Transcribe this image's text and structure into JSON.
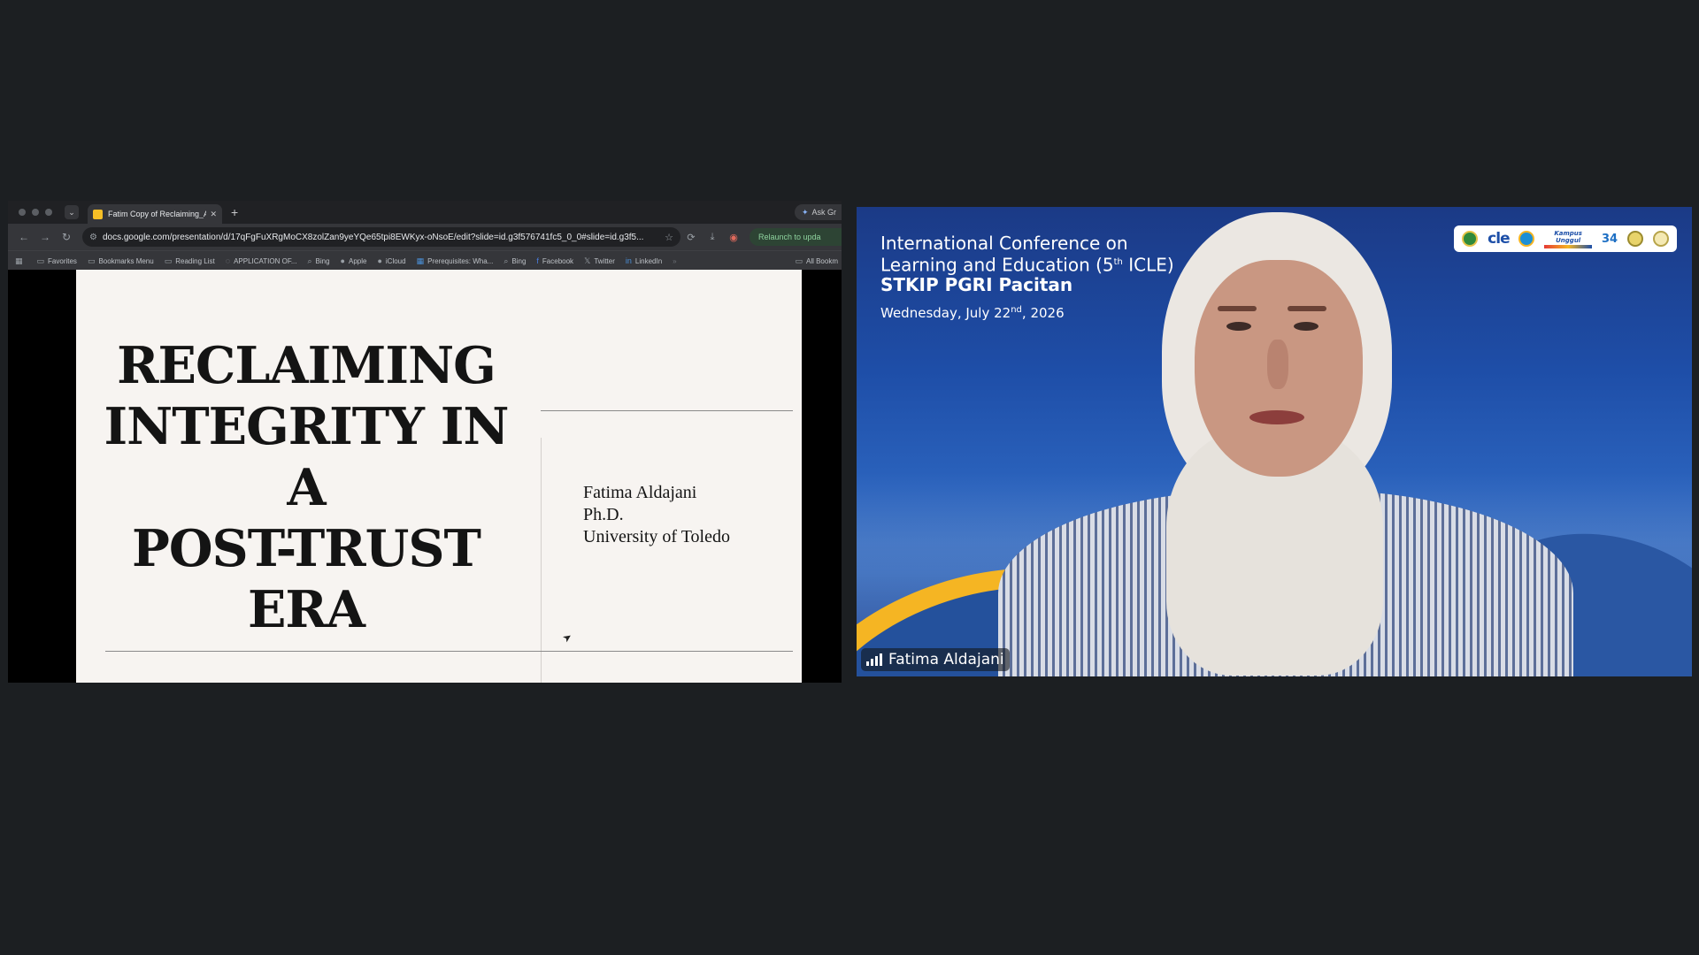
{
  "browser": {
    "tab_title": "Fatim Copy of Reclaiming_Ac",
    "tab_close": "✕",
    "new_tab": "+",
    "ask_button": "Ask Gr",
    "url": "docs.google.com/presentation/d/17qFgFuXRgMoCX8zolZan9yeYQe65tpi8EWKyx-oNsoE/edit?slide=id.g3f576741fc5_0_0#slide=id.g3f5...",
    "relaunch": "Relaunch to upda",
    "bookmarks": [
      {
        "label": "Favorites",
        "icon": "folder-icon"
      },
      {
        "label": "Bookmarks Menu",
        "icon": "folder-icon"
      },
      {
        "label": "Reading List",
        "icon": "folder-icon"
      },
      {
        "label": "APPLICATION OF...",
        "icon": "globe-icon"
      },
      {
        "label": "Bing",
        "icon": "search-icon"
      },
      {
        "label": "Apple",
        "icon": "apple-icon"
      },
      {
        "label": "iCloud",
        "icon": "apple-icon"
      },
      {
        "label": "Prerequisites: Wha...",
        "icon": "grid-icon"
      },
      {
        "label": "Bing",
        "icon": "search-icon"
      },
      {
        "label": "Facebook",
        "icon": "facebook-icon"
      },
      {
        "label": "Twitter",
        "icon": "x-icon"
      },
      {
        "label": "LinkedIn",
        "icon": "linkedin-icon"
      }
    ],
    "bookmarks_overflow": "»",
    "all_bookmarks": "All Bookm"
  },
  "slide": {
    "title_lines": [
      "RECLAIMING",
      "INTEGRITY IN A",
      "POST-TRUST",
      "ERA"
    ],
    "presenter_lines": [
      "Fatima Aldajani",
      "Ph.D.",
      "University of Toledo"
    ]
  },
  "video": {
    "conference_lines": [
      {
        "text": "International Conference on",
        "sup": "",
        "after": ""
      },
      {
        "text": "Learning and Education (5",
        "sup": "th",
        "after": " ICLE)"
      },
      {
        "text": "STKIP PGRI Pacitan",
        "sup": "",
        "after": ""
      }
    ],
    "date": {
      "text": "Wednesday, July 22",
      "sup": "nd",
      "after": ", 2026"
    },
    "logos": {
      "cle": "cle",
      "kampus": "Kampus Unggul",
      "anniv": "34"
    },
    "participant_name": "Fatima Aldajani"
  },
  "colors": {
    "background": "#1c1f22",
    "slide_bg": "#f7f4f1",
    "video_blue": "#1e4ea8",
    "accent_yellow": "#f5b523"
  }
}
